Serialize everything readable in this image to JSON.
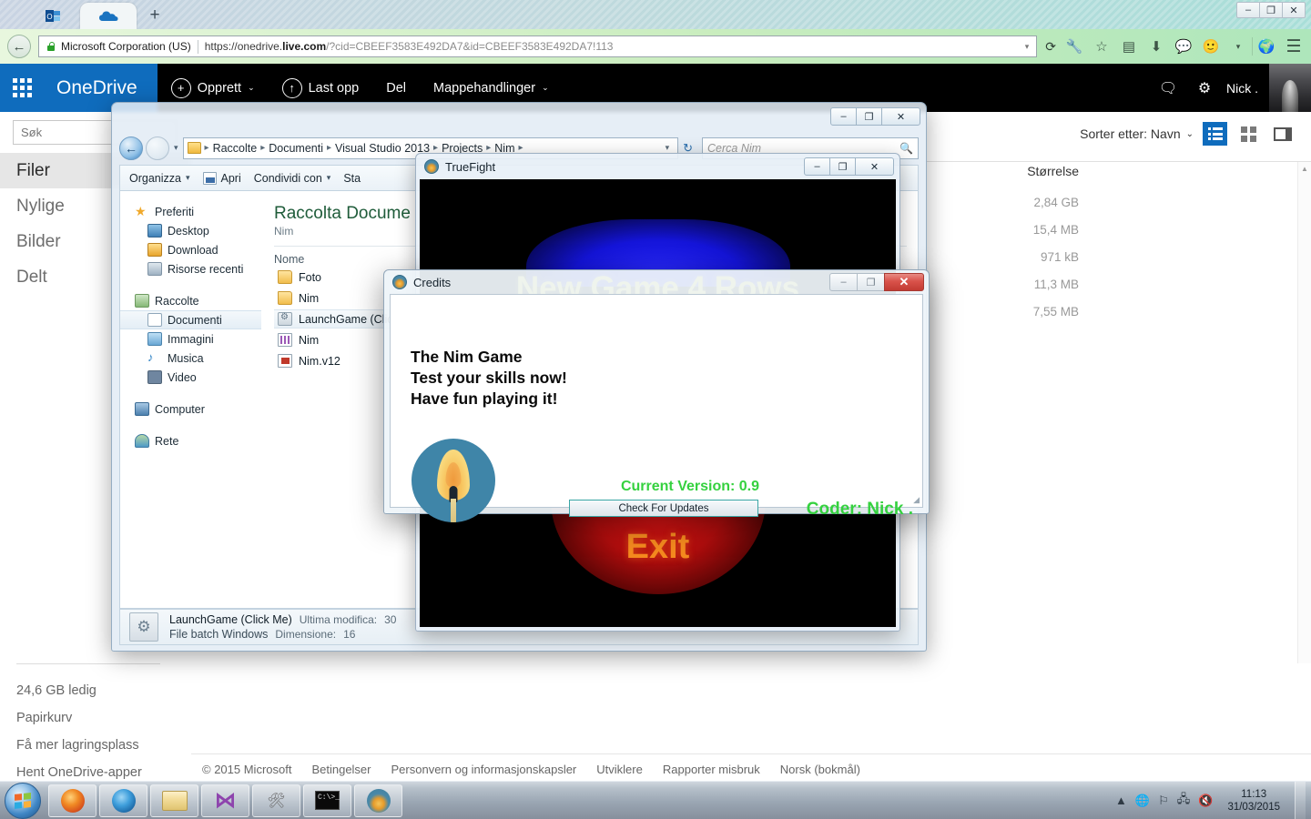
{
  "browser": {
    "tabs": [
      {
        "name": "outlook-tab",
        "icon": "outlook-icon",
        "active": false
      },
      {
        "name": "onedrive-tab",
        "icon": "onedrive-cloud-icon",
        "active": true
      }
    ],
    "new_tab_label": "+",
    "window_buttons": [
      "–",
      "❐",
      "✕"
    ],
    "back_arrow": "←",
    "url": {
      "owner": "Microsoft Corporation (US)",
      "scheme": "https://",
      "host_prefix": "onedrive.",
      "host_bold": "live.com",
      "path": "/?cid=CBEEF3583E492DA7&id=CBEEF3583E492DA7!113"
    },
    "dropdown": "▾",
    "reload": "⟳",
    "nav_icons": [
      "wrench-icon",
      "star-icon",
      "clipboard-icon",
      "download-icon",
      "chat-icon",
      "smiley-icon",
      "chevron-down-icon",
      "globe-icon",
      "hamburger-menu-icon"
    ]
  },
  "onedrive": {
    "brand": "OneDrive",
    "waffle": "app-launcher",
    "menu": [
      {
        "label": "Opprett",
        "icon": "plus-circle-icon",
        "caret": "⌄"
      },
      {
        "label": "Last opp",
        "icon": "upload-circle-icon",
        "caret": ""
      },
      {
        "label": "Del",
        "icon": "",
        "caret": ""
      },
      {
        "label": "Mappehandlinger",
        "icon": "",
        "caret": "⌄"
      }
    ],
    "header_right": {
      "chat_icon": "chat-bubble-icon",
      "settings_icon": "gear-icon",
      "user": "Nick ."
    },
    "search": {
      "placeholder": "Søk",
      "value": ""
    },
    "nav": [
      {
        "label": "Filer",
        "selected": true
      },
      {
        "label": "Nylige",
        "selected": false
      },
      {
        "label": "Bilder",
        "selected": false
      },
      {
        "label": "Delt",
        "selected": false
      }
    ],
    "sidebar_bottom": [
      "24,6 GB ledig",
      "Papirkurv",
      "Få mer lagringsplass",
      "Hent OneDrive-apper"
    ],
    "toolbar": {
      "sort_label": "Sorter etter: Navn",
      "sort_caret": "⌄",
      "views": [
        "list-view-icon",
        "tiles-view-icon",
        "details-pane-icon"
      ]
    },
    "column_header": "Størrelse",
    "sizes": [
      "2,84 GB",
      "15,4 MB",
      "971 kB",
      "11,3 MB",
      "7,55 MB"
    ],
    "footer": [
      "© 2015 Microsoft",
      "Betingelser",
      "Personvern og informasjonskapsler",
      "Utviklere",
      "Rapporter misbruk",
      "Norsk (bokmål)"
    ]
  },
  "explorer": {
    "window_buttons": [
      "–",
      "❐",
      "✕"
    ],
    "breadcrumb": [
      "Raccolte",
      "Documenti",
      "Visual Studio 2013",
      "Projects",
      "Nim"
    ],
    "breadcrumb_sep": "▸",
    "search_placeholder": "Cerca Nim",
    "toolbar": [
      {
        "label": "Organizza",
        "caret": "▾",
        "icon": ""
      },
      {
        "label": "Apri",
        "caret": "",
        "icon": "open-file-icon"
      },
      {
        "label": "Condividi con",
        "caret": "▾",
        "icon": ""
      },
      {
        "label": "Sta",
        "caret": "",
        "icon": ""
      }
    ],
    "nav_groups": [
      {
        "header": {
          "label": "Preferiti",
          "icon": "star-icon"
        },
        "items": [
          {
            "label": "Desktop",
            "icon": "desktop-icon"
          },
          {
            "label": "Download",
            "icon": "download-folder-icon"
          },
          {
            "label": "Risorse recenti",
            "icon": "recent-places-icon"
          }
        ]
      },
      {
        "header": {
          "label": "Raccolte",
          "icon": "libraries-icon"
        },
        "items": [
          {
            "label": "Documenti",
            "icon": "documents-icon",
            "selected": true
          },
          {
            "label": "Immagini",
            "icon": "pictures-icon",
            "selected": false
          },
          {
            "label": "Musica",
            "icon": "music-icon",
            "selected": false
          },
          {
            "label": "Video",
            "icon": "video-icon",
            "selected": false
          }
        ]
      },
      {
        "header": {
          "label": "Computer",
          "icon": "computer-icon"
        },
        "items": []
      },
      {
        "header": {
          "label": "Rete",
          "icon": "network-icon"
        },
        "items": []
      }
    ],
    "library_title": "Raccolta Docume",
    "library_sub": "Nim",
    "column_name": "Nome",
    "files": [
      {
        "label": "Foto",
        "icon": "folder-icon",
        "selected": false
      },
      {
        "label": "Nim",
        "icon": "folder-icon",
        "selected": false
      },
      {
        "label": "LaunchGame (Clic",
        "icon": "batch-file-icon",
        "selected": true
      },
      {
        "label": "Nim",
        "icon": "solution-file-icon",
        "selected": false
      },
      {
        "label": "Nim.v12",
        "icon": "suo-file-icon",
        "selected": false
      }
    ],
    "status": {
      "name": "LaunchGame (Click Me)",
      "type": "File batch Windows",
      "modified_label": "Ultima modifica:",
      "modified_value": "30",
      "size_label": "Dimensione:",
      "size_value": "16"
    }
  },
  "truefight": {
    "title": "TrueFight",
    "window_buttons": [
      "–",
      "❐",
      "✕"
    ],
    "new_game_label": "New Game 4 Rows",
    "exit_label": "Exit"
  },
  "credits": {
    "title": "Credits",
    "window_buttons": [
      "–",
      "❐",
      "✕"
    ],
    "lines": [
      "The Nim Game",
      "Test your skills now!",
      "Have fun playing it!"
    ],
    "logo": "candle-flame-icon",
    "version_text": "Current Version: 0.9",
    "update_button": "Check For Updates",
    "coder_text": "Coder: Nick .",
    "colors": {
      "green_text": "#35d13f",
      "button_border": "#3aa5a5",
      "close_button": "#d9524a",
      "logo_circle": "#3f85a8"
    }
  },
  "taskbar": {
    "start": "windows-start-orb",
    "buttons": [
      "firefox-icon",
      "blue-browser-icon",
      "explorer-folder-icon",
      "visual-studio-icon",
      "tools-icon",
      "command-prompt-icon",
      "nim-candle-icon"
    ],
    "cmd_glyph": "C:\\>_",
    "tray_icons": [
      "show-hidden-icon",
      "network-globe-icon",
      "action-flag-icon",
      "network-monitor-icon",
      "volume-muted-icon"
    ],
    "clock_time": "11:13",
    "clock_date": "31/03/2015"
  }
}
